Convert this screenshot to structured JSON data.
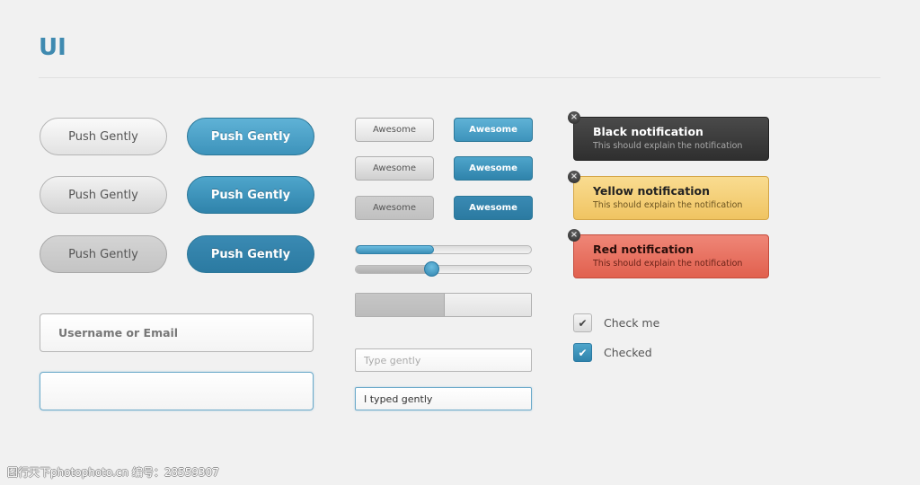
{
  "header": {
    "title": "UI"
  },
  "pill_buttons": {
    "gray": [
      "Push Gently",
      "Push Gently",
      "Push Gently"
    ],
    "blue": [
      "Push Gently",
      "Push Gently",
      "Push Gently"
    ]
  },
  "small_buttons": {
    "gray": [
      "Awesome",
      "Awesome",
      "Awesome"
    ],
    "blue": [
      "Awesome",
      "Awesome",
      "Awesome"
    ]
  },
  "progress": {
    "value_percent": 44
  },
  "slider": {
    "value_percent": 43
  },
  "segmented": {
    "selected_index": 0,
    "segments": 2
  },
  "inputs": {
    "username": {
      "placeholder": "Username or Email",
      "value": ""
    },
    "focused_large": {
      "placeholder": "",
      "value": ""
    },
    "type_gently": {
      "placeholder": "Type gently",
      "value": ""
    },
    "typed": {
      "placeholder": "",
      "value": "I typed gently"
    }
  },
  "notifications": [
    {
      "title": "Black notification",
      "body": "This should explain the notification",
      "color": "#383838"
    },
    {
      "title": "Yellow notification",
      "body": "This should explain the notification",
      "color": "#f4cf76"
    },
    {
      "title": "Red notification",
      "body": "This should explain the notification",
      "color": "#e8705f"
    }
  ],
  "checkboxes": [
    {
      "label": "Check me",
      "checked": false
    },
    {
      "label": "Checked",
      "checked": true
    }
  ],
  "icons": {
    "close": "×",
    "check": "✔"
  },
  "colors": {
    "accent": "#3f8ab0",
    "background": "#f1f1f1"
  },
  "watermark": "图行天下photophoto.cn 编号：28559307"
}
